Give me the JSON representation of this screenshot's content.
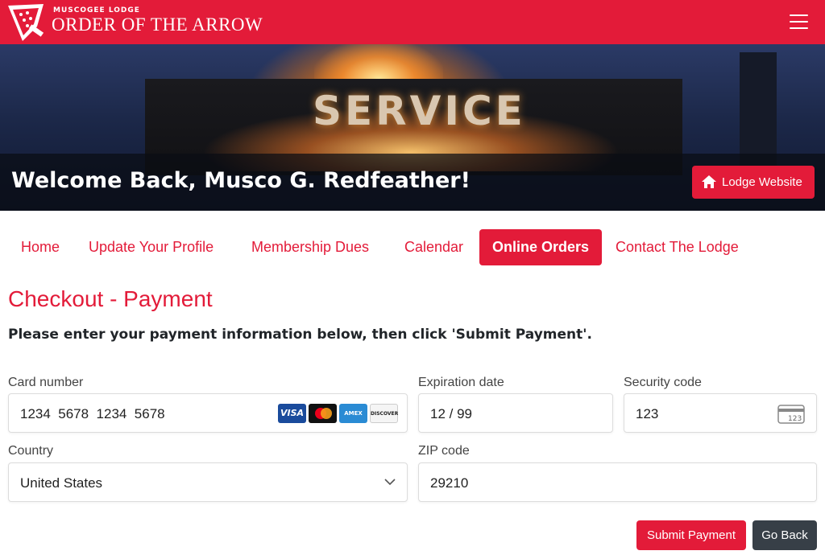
{
  "header": {
    "lodge_name": "MUSCOGEE LODGE",
    "org_name": "ORDER OF THE ARROW",
    "logo_icon": "arrowhead-logo-icon",
    "menu_icon": "hamburger-menu-icon",
    "brand_color": "#e31b39"
  },
  "hero": {
    "sign_text": "SERVICE",
    "welcome": "Welcome Back, Musco G. Redfeather!",
    "lodge_button": "Lodge Website",
    "lodge_button_icon": "home-icon"
  },
  "nav": {
    "items": [
      {
        "label": "Home",
        "active": false
      },
      {
        "label": "Update Your Profile",
        "active": false
      },
      {
        "label": "Membership Dues",
        "active": false
      },
      {
        "label": "Calendar",
        "active": false
      },
      {
        "label": "Online Orders",
        "active": true
      },
      {
        "label": "Contact The Lodge",
        "active": false
      }
    ]
  },
  "page": {
    "title": "Checkout - Payment",
    "instructions": "Please enter your payment information below, then click 'Submit Payment'."
  },
  "form": {
    "card_number": {
      "label": "Card number",
      "value": "1234  5678  1234  5678"
    },
    "card_brands": [
      "VISA",
      "",
      "AMEX",
      "DISCOVER"
    ],
    "expiration": {
      "label": "Expiration date",
      "value": "12 / 99"
    },
    "security": {
      "label": "Security code",
      "value": "123",
      "icon": "cvc-card-icon",
      "icon_text": "123"
    },
    "country": {
      "label": "Country",
      "value": "United States",
      "icon": "chevron-down-icon"
    },
    "zip": {
      "label": "ZIP code",
      "value": "29210"
    }
  },
  "actions": {
    "submit": "Submit Payment",
    "back": "Go Back",
    "submit_color": "#e31b39",
    "back_color": "#373f47"
  }
}
